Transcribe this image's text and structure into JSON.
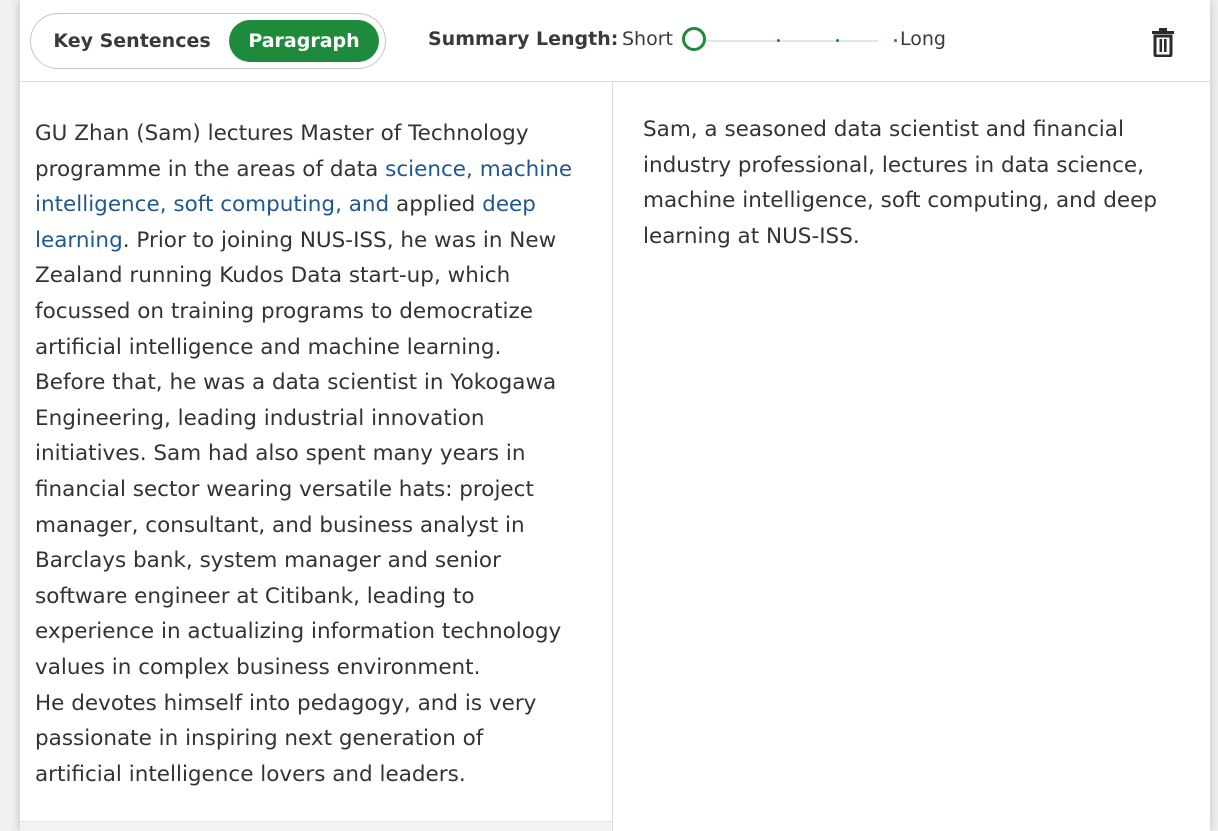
{
  "toolbar": {
    "mode_key_sentences": "Key Sentences",
    "mode_paragraph": "Paragraph",
    "active_mode": "Paragraph",
    "summary_length_label": "Summary Length:",
    "short_label": "Short",
    "long_label": "Long",
    "slider_value_fraction": 0,
    "slider_stops": 4,
    "delete_icon": "trash-icon"
  },
  "original": {
    "p1_a": "GU Zhan (Sam) lectures Master of Technology programme in the areas of data ",
    "p1_hl1": "science, machine intelligence, soft computing, and",
    "p1_b": " applied ",
    "p1_hl2": "deep learning",
    "p1_c": ". Prior to joining NUS-ISS, he was in New Zealand running Kudos Data start-up, which focussed on training programs to democratize artificial intelligence and machine learning. Before that, he was a data scientist in Yokogawa Engineering, leading industrial innovation initiatives. Sam had also spent many years in financial sector wearing versatile hats: project manager, consultant, and business analyst in Barclays bank, system manager and senior software engineer at Citibank, leading to experience in actualizing information technology values in complex business environment.",
    "p2": "He devotes himself into pedagogy, and is very passionate in inspiring next generation of artificial intelligence lovers and leaders."
  },
  "summary": {
    "text": "Sam, a seasoned data scientist and financial industry professional, lectures in data science, machine intelligence, soft computing, and deep learning at NUS-ISS."
  },
  "colors": {
    "accent": "#1e8a3c",
    "link": "#1f5790",
    "text": "#333333",
    "border": "#dcdcdc"
  }
}
